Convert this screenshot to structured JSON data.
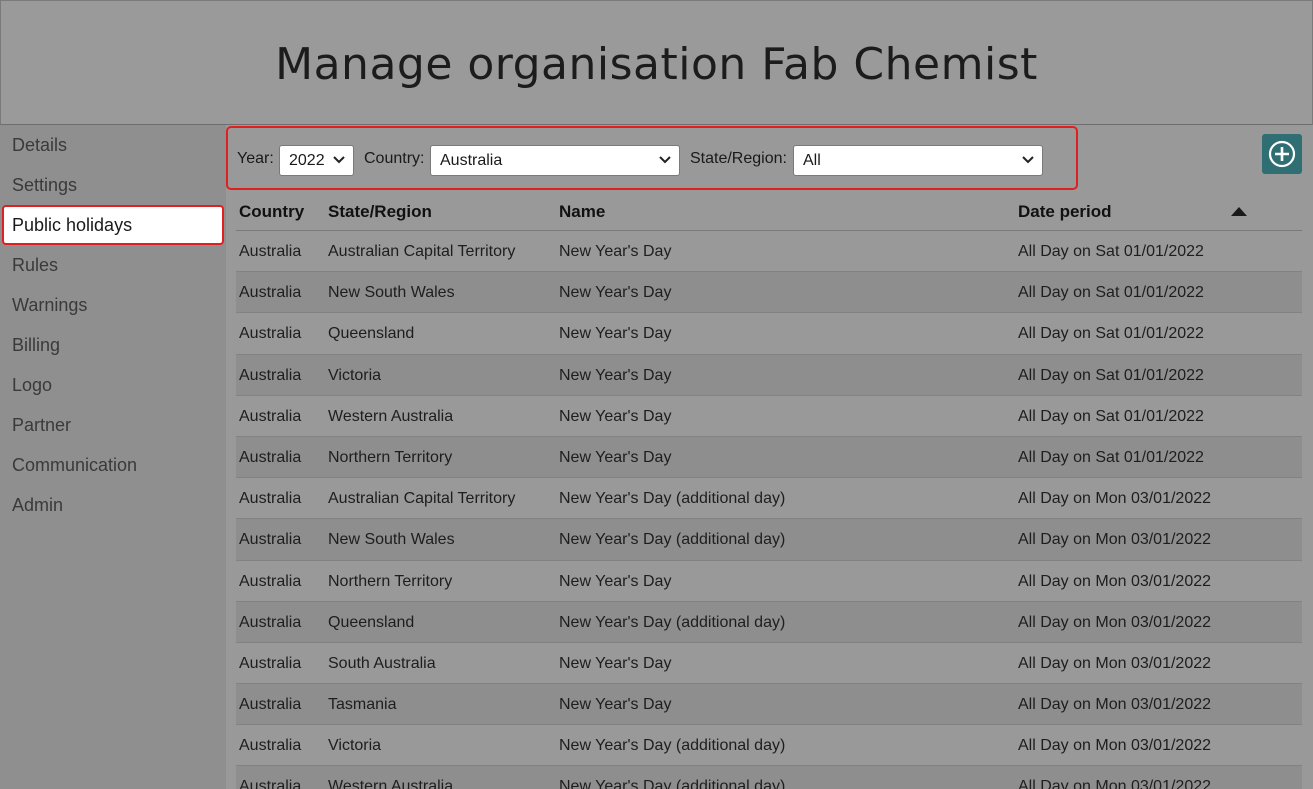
{
  "page_title": "Manage organisation Fab Chemist",
  "sidebar": {
    "items": [
      {
        "label": "Details"
      },
      {
        "label": "Settings"
      },
      {
        "label": "Public holidays"
      },
      {
        "label": "Rules"
      },
      {
        "label": "Warnings"
      },
      {
        "label": "Billing"
      },
      {
        "label": "Logo"
      },
      {
        "label": "Partner"
      },
      {
        "label": "Communication"
      },
      {
        "label": "Admin"
      }
    ],
    "active": "Public holidays"
  },
  "filters": {
    "year_label": "Year:",
    "year_value": "2022",
    "country_label": "Country:",
    "country_value": "Australia",
    "state_label": "State/Region:",
    "state_value": "All"
  },
  "add_button_icon": "plus-circle-icon",
  "table": {
    "headers": {
      "country": "Country",
      "state": "State/Region",
      "name": "Name",
      "date": "Date period"
    },
    "sort_icon": "sort-up-icon",
    "rows": [
      {
        "country": "Australia",
        "state": "Australian Capital Territory",
        "name": "New Year's Day",
        "date": "All Day on Sat 01/01/2022"
      },
      {
        "country": "Australia",
        "state": "New South Wales",
        "name": "New Year's Day",
        "date": "All Day on Sat 01/01/2022"
      },
      {
        "country": "Australia",
        "state": "Queensland",
        "name": "New Year's Day",
        "date": "All Day on Sat 01/01/2022"
      },
      {
        "country": "Australia",
        "state": "Victoria",
        "name": "New Year's Day",
        "date": "All Day on Sat 01/01/2022"
      },
      {
        "country": "Australia",
        "state": "Western Australia",
        "name": "New Year's Day",
        "date": "All Day on Sat 01/01/2022"
      },
      {
        "country": "Australia",
        "state": "Northern Territory",
        "name": "New Year's Day",
        "date": "All Day on Sat 01/01/2022"
      },
      {
        "country": "Australia",
        "state": "Australian Capital Territory",
        "name": "New Year's Day (additional day)",
        "date": "All Day on Mon 03/01/2022"
      },
      {
        "country": "Australia",
        "state": "New South Wales",
        "name": "New Year's Day (additional day)",
        "date": "All Day on Mon 03/01/2022"
      },
      {
        "country": "Australia",
        "state": "Northern Territory",
        "name": "New Year's Day",
        "date": "All Day on Mon 03/01/2022"
      },
      {
        "country": "Australia",
        "state": "Queensland",
        "name": "New Year's Day (additional day)",
        "date": "All Day on Mon 03/01/2022"
      },
      {
        "country": "Australia",
        "state": "South Australia",
        "name": "New Year's Day",
        "date": "All Day on Mon 03/01/2022"
      },
      {
        "country": "Australia",
        "state": "Tasmania",
        "name": "New Year's Day",
        "date": "All Day on Mon 03/01/2022"
      },
      {
        "country": "Australia",
        "state": "Victoria",
        "name": "New Year's Day (additional day)",
        "date": "All Day on Mon 03/01/2022"
      },
      {
        "country": "Australia",
        "state": "Western Australia",
        "name": "New Year's Day (additional day)",
        "date": "All Day on Mon 03/01/2022"
      }
    ]
  },
  "colors": {
    "highlight": "#e02020",
    "add_button": "#2f6f73"
  }
}
